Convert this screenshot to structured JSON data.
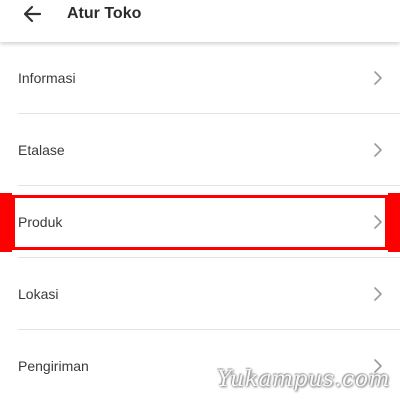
{
  "header": {
    "title": "Atur Toko",
    "back_icon": "arrow-left-icon"
  },
  "menu": {
    "items": [
      {
        "label": "Informasi",
        "icon": "chevron-right-icon"
      },
      {
        "label": "Etalase",
        "icon": "chevron-right-icon"
      },
      {
        "label": "Produk",
        "icon": "chevron-right-icon",
        "highlighted": true
      },
      {
        "label": "Lokasi",
        "icon": "chevron-right-icon"
      },
      {
        "label": "Pengiriman",
        "icon": "chevron-right-icon"
      }
    ]
  },
  "annotation": {
    "highlight_color": "#ff0000"
  },
  "watermark": {
    "text": "Yukampus.com"
  }
}
